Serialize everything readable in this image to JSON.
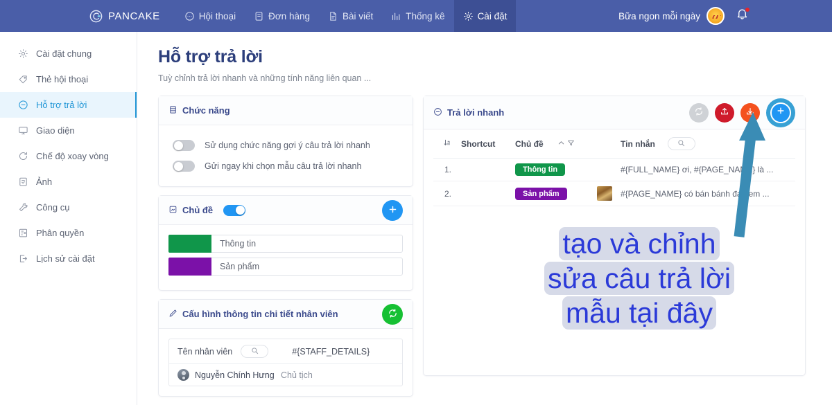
{
  "topbar": {
    "brand": "PANCAKE",
    "brand_icon": "pancake-logo-icon",
    "nav": [
      {
        "label": "Hội thoại",
        "icon": "chat-icon",
        "active": false
      },
      {
        "label": "Đơn hàng",
        "icon": "order-icon",
        "active": false
      },
      {
        "label": "Bài viết",
        "icon": "post-icon",
        "active": false
      },
      {
        "label": "Thống kê",
        "icon": "chart-bar-icon",
        "active": false
      },
      {
        "label": "Cài đặt",
        "icon": "gear-icon",
        "active": true
      }
    ],
    "page_name": "Bữa ngon mỗi ngày",
    "avatar_icon": "page-avatar",
    "bell_icon": "bell-icon",
    "has_notification": true,
    "bg_color": "#4a5ea8",
    "active_bg_color": "#3d4f94"
  },
  "sidebar": {
    "items": [
      {
        "label": "Cài đặt chung",
        "icon": "gear-icon",
        "active": false
      },
      {
        "label": "Thẻ hội thoại",
        "icon": "tag-icon",
        "active": false
      },
      {
        "label": "Hỗ trợ trả lời",
        "icon": "chat-bubble-icon",
        "active": true
      },
      {
        "label": "Giao diện",
        "icon": "monitor-icon",
        "active": false
      },
      {
        "label": "Chế độ xoay vòng",
        "icon": "refresh-icon",
        "active": false
      },
      {
        "label": "Ảnh",
        "icon": "image-icon",
        "active": false
      },
      {
        "label": "Công cụ",
        "icon": "wrench-icon",
        "active": false
      },
      {
        "label": "Phân quyền",
        "icon": "permissions-icon",
        "active": false
      },
      {
        "label": "Lịch sử cài đặt",
        "icon": "history-icon",
        "active": false
      }
    ],
    "active_color": "#2196d6",
    "active_bg": "#e9f5fd"
  },
  "page": {
    "title": "Hỗ trợ trả lời",
    "subtitle": "Tuỳ chỉnh trả lời nhanh và những tính năng liên quan ...",
    "title_color": "#2c3e7b"
  },
  "features_card": {
    "title": "Chức năng",
    "icon": "list-icon",
    "toggles": [
      {
        "label": "Sử dụng chức năng gợi ý câu trả lời nhanh",
        "on": false
      },
      {
        "label": "Gửi ngay khi chọn mẫu câu trả lời nhanh",
        "on": false
      }
    ]
  },
  "topics_card": {
    "title": "Chủ đề",
    "icon": "topic-icon",
    "toggle_on": true,
    "add_button": {
      "label": "+",
      "icon": "plus-icon",
      "color": "#2196f3"
    },
    "topics": [
      {
        "name": "Thông tin",
        "color": "#10964a"
      },
      {
        "name": "Sản phẩm",
        "color": "#7b11a8"
      }
    ]
  },
  "staff_card": {
    "title": "Cấu hình thông tin chi tiết nhân viên",
    "icon": "pen-icon",
    "refresh_button": {
      "icon": "refresh-icon",
      "color": "#16c033"
    },
    "headers": {
      "name": "Tên nhân viên",
      "search_icon": "search-icon",
      "code": "#{STAFF_DETAILS}"
    },
    "rows": [
      {
        "avatar": "staff-avatar",
        "name": "Nguyễn Chính Hưng",
        "role": "Chủ tịch"
      }
    ]
  },
  "quick_reply_card": {
    "title": "Trả lời nhanh",
    "icon": "chat-bubble-icon",
    "actions": [
      {
        "name": "refresh-button",
        "icon": "refresh-icon",
        "color": "#cfd2d6"
      },
      {
        "name": "import-button",
        "icon": "upload-icon",
        "color": "#cf1b2b"
      },
      {
        "name": "export-button",
        "icon": "download-icon",
        "color": "#f4511e"
      },
      {
        "name": "add-button",
        "icon": "plus-icon",
        "color": "#2196f3",
        "highlighted": true
      }
    ],
    "table": {
      "headers": {
        "sort_icon": "sort-icon",
        "shortcut": "Shortcut",
        "topic": "Chủ đề",
        "topic_sort_icon": "caret-up-icon",
        "topic_filter_icon": "filter-icon",
        "message": "Tin nhắn",
        "message_search_icon": "search-icon"
      },
      "rows": [
        {
          "index": "1.",
          "shortcut": "",
          "topic": "Thông tin",
          "topic_color": "#10964a",
          "thumbnail": false,
          "message": "#{FULL_NAME} ơi, #{PAGE_NAME} là ..."
        },
        {
          "index": "2.",
          "shortcut": "",
          "topic": "Sản phẩm",
          "topic_color": "#7b11a8",
          "thumbnail": true,
          "message": "#{PAGE_NAME} có bán bánh đa nem ..."
        }
      ]
    }
  },
  "annotation": {
    "lines": [
      "tạo và chỉnh",
      "sửa câu trả lời",
      "mẫu tại đây"
    ],
    "text_color": "#2b3ad8",
    "highlight_color": "#d6dae8",
    "arrow_color": "#3a8cb5",
    "arrow_name": "annotation-arrow"
  }
}
